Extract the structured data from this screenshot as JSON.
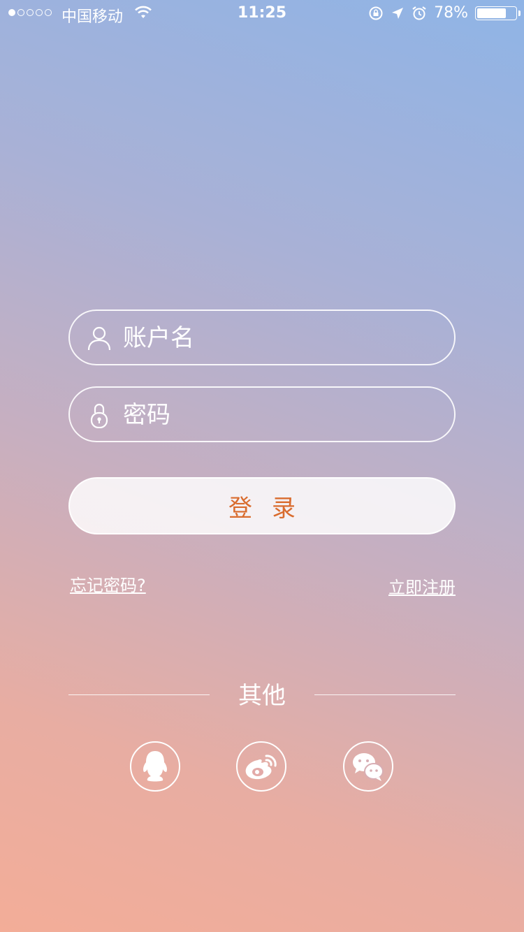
{
  "status_bar": {
    "carrier": "中国移动",
    "time": "11:25",
    "battery_percent": "78%",
    "battery_level": 0.78,
    "signal_strength": 1
  },
  "login_form": {
    "username_placeholder": "账户名",
    "password_placeholder": "密码",
    "login_label": "登录"
  },
  "links": {
    "forgot_password": "忘记密码?",
    "register": "立即注册"
  },
  "other_login": {
    "label": "其他",
    "providers": [
      "qq-icon",
      "weibo-icon",
      "wechat-icon"
    ]
  },
  "colors": {
    "accent": "#d96c2e"
  }
}
